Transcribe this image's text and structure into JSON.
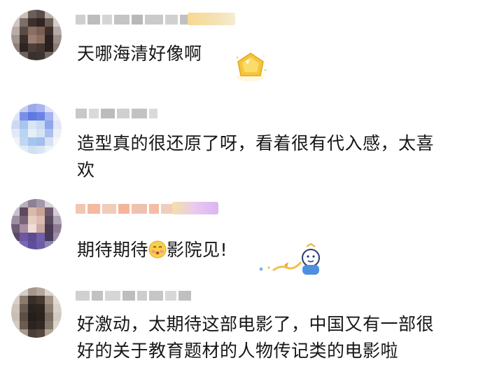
{
  "comments": [
    {
      "text_lines": [
        "天哪海清好像啊"
      ],
      "sticker": "gold-gem-sticker"
    },
    {
      "text_lines": [
        "造型真的很还原了呀，看着很有代入感，太喜",
        "欢"
      ]
    },
    {
      "text_before_emoji": "期待期待",
      "emoji": "blushing-face-emoji",
      "text_after_emoji": "影院见!",
      "sticker": "cartoon-character-sticker"
    },
    {
      "text_lines": [
        "好激动，太期待这部电影了，中国又有一部很",
        "好的关于教育题材的人物传记类的电影啦"
      ]
    }
  ],
  "colors": {
    "text": "#161616",
    "username_blur": "#c9c9c9",
    "badge_gold": "#f6d27a",
    "badge_pink": "#e8b8f0"
  }
}
